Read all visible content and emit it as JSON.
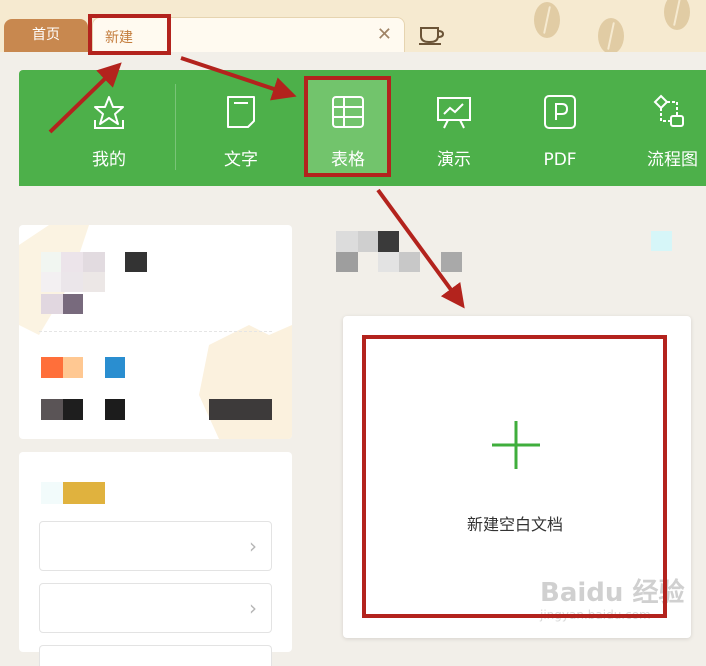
{
  "tabs": {
    "home_label": "首页",
    "new_label": "新建",
    "close_symbol": "✕"
  },
  "toolbar": {
    "items": [
      {
        "label": "我的",
        "icon": "star-icon"
      },
      {
        "label": "文字",
        "icon": "document-icon"
      },
      {
        "label": "表格",
        "icon": "spreadsheet-icon",
        "active": true
      },
      {
        "label": "演示",
        "icon": "presentation-icon"
      },
      {
        "label": "PDF",
        "icon": "pdf-icon"
      },
      {
        "label": "流程图",
        "icon": "flowchart-icon"
      }
    ]
  },
  "main": {
    "new_blank_label": "新建空白文档"
  },
  "colors": {
    "toolbar_green": "#4db04a",
    "active_green": "#72c46c",
    "annotation_red": "#b3231d",
    "tab_brown": "#c8884f"
  },
  "watermark": {
    "logo_text": "Baidu 经验",
    "url_text": "jingyan.baidu.com"
  }
}
